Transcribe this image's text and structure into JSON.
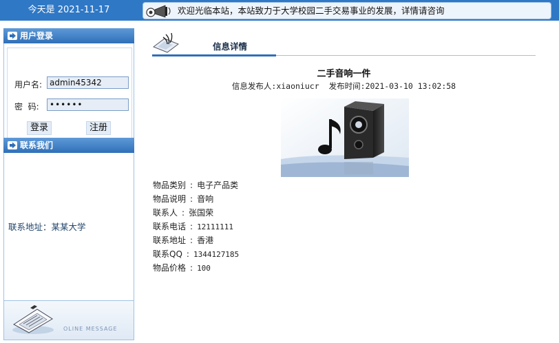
{
  "header": {
    "date_text": "今天是 2021-11-17",
    "marquee_text": "欢迎光临本站，本站致力于大学校园二手交易事业的发展，详情请咨询"
  },
  "login": {
    "title": "用户登录",
    "username_label": "用户名:",
    "username_value": "admin45342",
    "password_label": "密  码:",
    "password_value": "••••••",
    "login_button": "登录",
    "register_button": "注册"
  },
  "contact": {
    "title": "联系我们",
    "address_text": "联系地址：某某大学"
  },
  "message": {
    "label": "OLINE MESSAGE"
  },
  "detail": {
    "section_title": "信息详情",
    "item_title": "二手音响一件",
    "publisher_label": "信息发布人:",
    "publisher": "xiaoniucr",
    "time_label": "发布时间:",
    "time": "2021-03-10 13:02:58",
    "fields": [
      {
        "label": "物品类别",
        "value": "电子产品类"
      },
      {
        "label": "物品说明",
        "value": "音响"
      },
      {
        "label": "联系人",
        "value": "张国荣"
      },
      {
        "label": "联系电话",
        "value": "12111111"
      },
      {
        "label": "联系地址",
        "value": "香港"
      },
      {
        "label": "联系QQ",
        "value": "1344127185"
      },
      {
        "label": "物品价格",
        "value": "100"
      }
    ]
  },
  "icons": {
    "speaker": "megaphone-icon",
    "panel_head": "arrow-right-icon",
    "message": "message-icon",
    "detail_header": "decor-icon"
  },
  "colors": {
    "topbar": "#2f78c6",
    "panel_header": "#2f6fb8",
    "border": "#9ec1e6",
    "input_bg": "#e6edf6"
  }
}
